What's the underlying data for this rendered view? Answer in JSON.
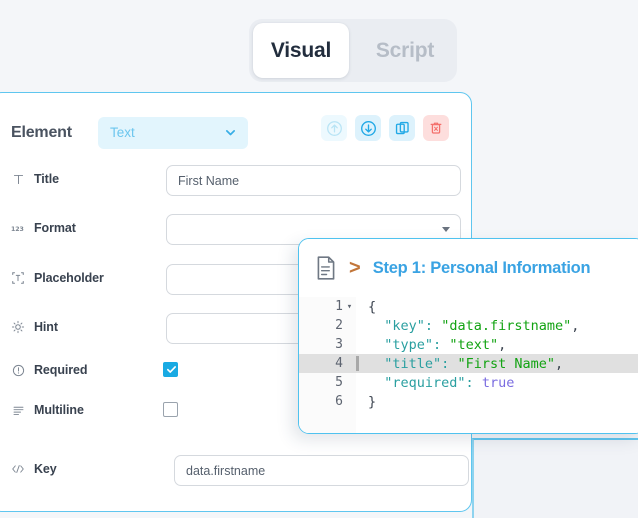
{
  "tabs": {
    "active_label": "Visual",
    "inactive_label": "Script"
  },
  "element_row": {
    "label": "Element",
    "type_value": "Text",
    "actions": [
      {
        "name": "move-up",
        "icon": "arrow-up-circle-icon"
      },
      {
        "name": "move-down",
        "icon": "arrow-down-circle-icon"
      },
      {
        "name": "duplicate",
        "icon": "copy-icon"
      },
      {
        "name": "delete",
        "icon": "trash-icon"
      }
    ]
  },
  "fields": [
    {
      "icon": "text-format-icon",
      "label": "Title",
      "value": "First Name",
      "kind": "input"
    },
    {
      "icon": "number-format-icon",
      "label": "Format",
      "value": "",
      "kind": "select"
    },
    {
      "icon": "placeholder-icon",
      "label": "Placeholder",
      "value": "",
      "kind": "input"
    },
    {
      "icon": "lightbulb-icon",
      "label": "Hint",
      "value": "",
      "kind": "input"
    },
    {
      "icon": "exclamation-circle-icon",
      "label": "Required",
      "value": "",
      "kind": "checkbox",
      "checked": true
    },
    {
      "icon": "lines-icon",
      "label": "Multiline",
      "value": "",
      "kind": "checkbox",
      "checked": false
    },
    {
      "icon": "code-brackets-icon",
      "label": "Key",
      "value": "data.firstname",
      "kind": "input"
    }
  ],
  "code_panel": {
    "breadcrumb": {
      "doc_icon": "document-icon",
      "separator": ">",
      "title": "Step 1: Personal Information"
    },
    "lines": [
      {
        "num": "1",
        "fold": "▾",
        "text": "{",
        "highlight": false
      },
      {
        "num": "2",
        "fold": "",
        "text": "  \"key\": \"data.firstname\",",
        "highlight": false
      },
      {
        "num": "3",
        "fold": "",
        "text": "  \"type\": \"text\",",
        "highlight": false
      },
      {
        "num": "4",
        "fold": "",
        "text": "  \"title\": \"First Name\",",
        "highlight": true
      },
      {
        "num": "5",
        "fold": "",
        "text": "  \"required\": true",
        "highlight": false
      },
      {
        "num": "6",
        "fold": "",
        "text": "}",
        "highlight": false
      }
    ]
  },
  "colors": {
    "page_background": "#f4f6f9",
    "panel_border": "#5fc6ef",
    "accent_blue": "#19aae3",
    "select_background": "#e2f5fd",
    "delete_background": "#fddedd",
    "code_key": "#2a9fa0",
    "code_string": "#13a313",
    "code_boolean": "#7a6ce0",
    "breadcrumb_title": "#3aa3e3",
    "breadcrumb_separator": "#c2763a"
  }
}
